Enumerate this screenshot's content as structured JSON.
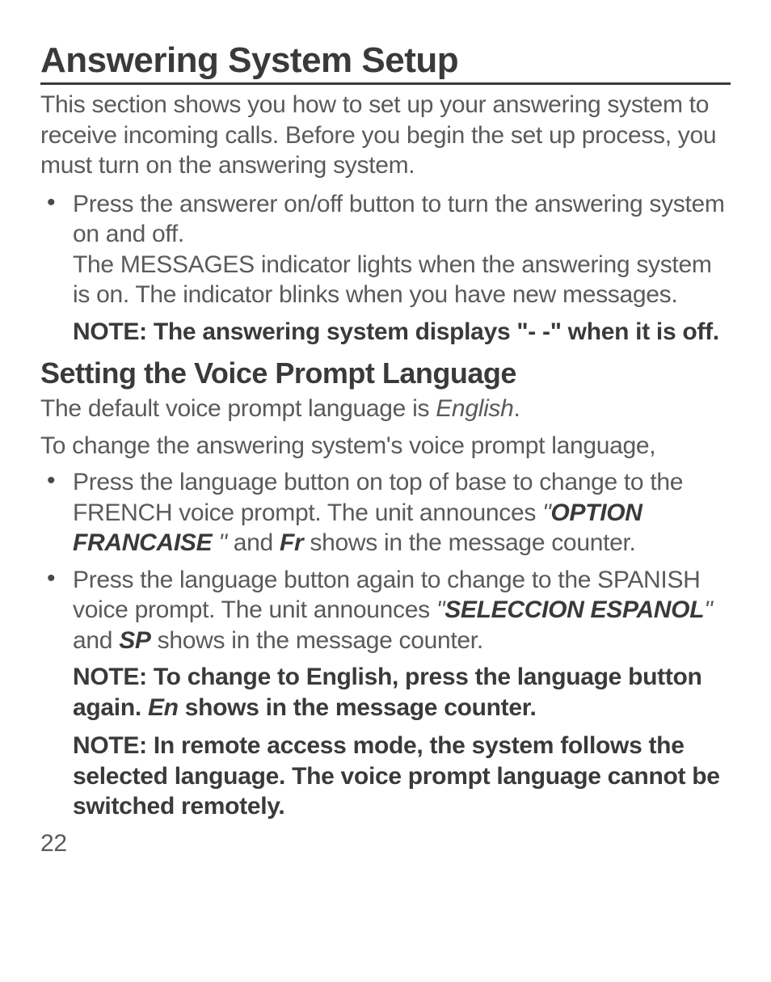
{
  "title": "Answering System Setup",
  "intro": "This section shows you how to set up your answering system to receive incoming calls. Before you begin the set up process, you must turn on the answering system.",
  "bullet1_line1": "Press the answerer on/off button to turn the answering system on and off.",
  "bullet1_line2": "The MESSAGES indicator lights when the answering system is on. The indicator blinks when you have new messages.",
  "note1": "NOTE: The answering system displays \"- -\" when it is off.",
  "section_heading": "Setting the Voice Prompt Language",
  "default_text_pre": "The default voice prompt language is ",
  "default_text_em": "English",
  "default_text_post": ".",
  "change_text": "To change the answering system's voice prompt language,",
  "bullet2_pre": "Press the language button on top of base to change to the FRENCH voice prompt. The unit announces ",
  "bullet2_quote_open": "\"",
  "bullet2_em1": "OPTION FRANCAISE ",
  "bullet2_quote_close": "\" ",
  "bullet2_mid": "and ",
  "bullet2_em2": "Fr",
  "bullet2_post": " shows in the message counter.",
  "bullet3_pre": "Press the language button again to change to the SPANISH voice prompt. The unit announces ",
  "bullet3_quote_open": "\"",
  "bullet3_em1": "SELECCION ESPANOL",
  "bullet3_quote_close": "\" ",
  "bullet3_mid": "and ",
  "bullet3_em2": "SP",
  "bullet3_post": " shows in the message counter.",
  "note2_pre": "NOTE: To change to English, press the language button again. ",
  "note2_em": "En",
  "note2_post": " shows in the message counter.",
  "note3": "NOTE: In remote access mode, the system follows the selected language. The voice prompt language cannot be switched remotely.",
  "page_number": "22"
}
